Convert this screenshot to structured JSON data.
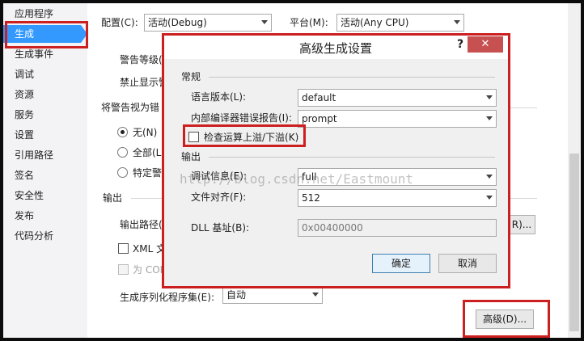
{
  "sidebar": {
    "items": [
      {
        "label": "应用程序"
      },
      {
        "label": "生成",
        "selected": true
      },
      {
        "label": "生成事件"
      },
      {
        "label": "调试"
      },
      {
        "label": "资源"
      },
      {
        "label": "服务"
      },
      {
        "label": "设置"
      },
      {
        "label": "引用路径"
      },
      {
        "label": "签名"
      },
      {
        "label": "安全性"
      },
      {
        "label": "发布"
      },
      {
        "label": "代码分析"
      }
    ]
  },
  "top": {
    "config_label": "配置(C):",
    "config_value": "活动(Debug)",
    "platform_label": "平台(M):",
    "platform_value": "活动(Any CPU)"
  },
  "main": {
    "warning_level_label": "警告等级(",
    "suppress_label": "禁止显示警",
    "treat_warnings_label": "将警告视为错",
    "radio_none": "无(N)",
    "radio_all": "全部(L)",
    "radio_specific": "特定警",
    "output_header": "输出",
    "output_path_label": "输出路径(",
    "xml_label": "XML 文",
    "com_label": "为 COM",
    "serialization_label": "生成序列化程序集(E):",
    "serialization_value": "自动",
    "browse_button": "R)...",
    "advanced_button": "高级(D)..."
  },
  "dialog": {
    "title": "高级生成设置",
    "help": "?",
    "close": "✕",
    "general_header": "常规",
    "lang_label": "语言版本(L):",
    "lang_value": "default",
    "compiler_report_label": "内部编译器错误报告(I):",
    "compiler_report_value": "prompt",
    "overflow_label": "检查运算上溢/下溢(K)",
    "output_header": "输出",
    "debug_info_label": "调试信息(E):",
    "debug_info_value": "full",
    "file_align_label": "文件对齐(F):",
    "file_align_value": "512",
    "dll_base_label": "DLL 基址(B):",
    "dll_base_value": "0x00400000",
    "ok_button": "确定",
    "cancel_button": "取消"
  },
  "watermark": "http://blog.csdn.net/Eastmount",
  "colors": {
    "accent": "#3399ff",
    "highlight_box": "#cc1f1f",
    "close_button": "#c75050"
  }
}
